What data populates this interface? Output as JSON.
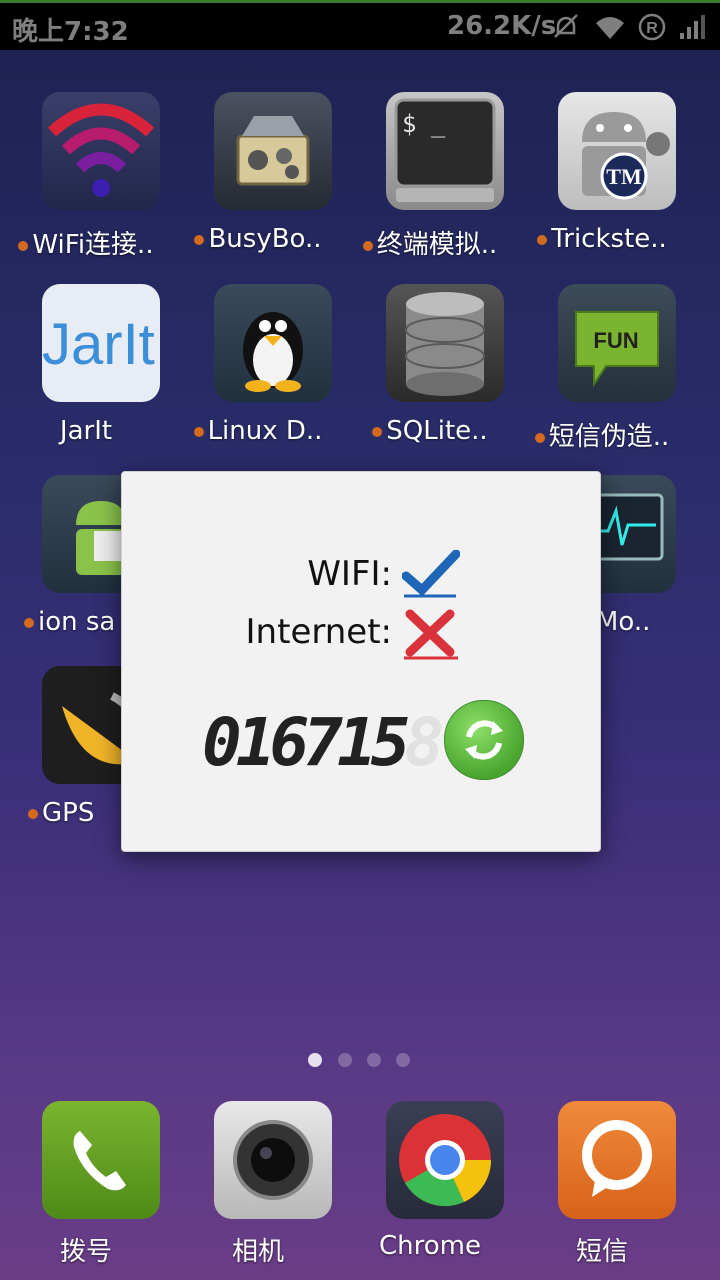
{
  "statusbar": {
    "time": "晚上7:32",
    "speed": "26.2K/s"
  },
  "apps": [
    {
      "label": "WiFi连接..",
      "dot": true
    },
    {
      "label": "BusyBo..",
      "dot": true
    },
    {
      "label": "终端模拟..",
      "dot": true
    },
    {
      "label": "Trickste..",
      "dot": true
    },
    {
      "label": "JarIt",
      "dot": false
    },
    {
      "label": "Linux D..",
      "dot": true
    },
    {
      "label": "SQLite..",
      "dot": true
    },
    {
      "label": "短信伪造..",
      "dot": true
    },
    {
      "label": "ion sa",
      "dot": true
    },
    {
      "label": "Os Mo..",
      "dot": false
    },
    {
      "label": "GPS",
      "dot": true
    }
  ],
  "dock": [
    {
      "label": "拨号"
    },
    {
      "label": "相机"
    },
    {
      "label": "Chrome"
    },
    {
      "label": "短信"
    }
  ],
  "dialog": {
    "wifi_label": "WIFI:",
    "internet_label": "Internet:",
    "digits": "016715",
    "digits_ghost": "8"
  },
  "icons": {
    "jarit_text": "JarIt",
    "fun_text": "FUN",
    "tm_text": "TM",
    "terminal_prompt": "$ _"
  },
  "colors": {
    "status_border": "#3c7a2c",
    "dot": "#d36a1e",
    "refresh": "#5cb63b"
  }
}
